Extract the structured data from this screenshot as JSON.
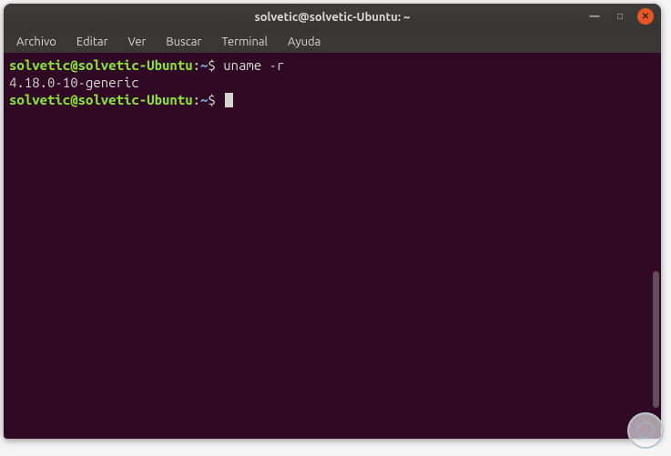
{
  "window": {
    "title": "solvetic@solvetic-Ubuntu: ~"
  },
  "menubar": {
    "items": [
      {
        "label": "Archivo"
      },
      {
        "label": "Editar"
      },
      {
        "label": "Ver"
      },
      {
        "label": "Buscar"
      },
      {
        "label": "Terminal"
      },
      {
        "label": "Ayuda"
      }
    ]
  },
  "terminal": {
    "lines": [
      {
        "prompt_user": "solvetic@solvetic-Ubuntu",
        "prompt_sep": ":",
        "prompt_path": "~",
        "prompt_sigil": "$ ",
        "command": "uname -r"
      }
    ],
    "output": "4.18.0-10-generic",
    "prompt2": {
      "prompt_user": "solvetic@solvetic-Ubuntu",
      "prompt_sep": ":",
      "prompt_path": "~",
      "prompt_sigil": "$ "
    }
  }
}
